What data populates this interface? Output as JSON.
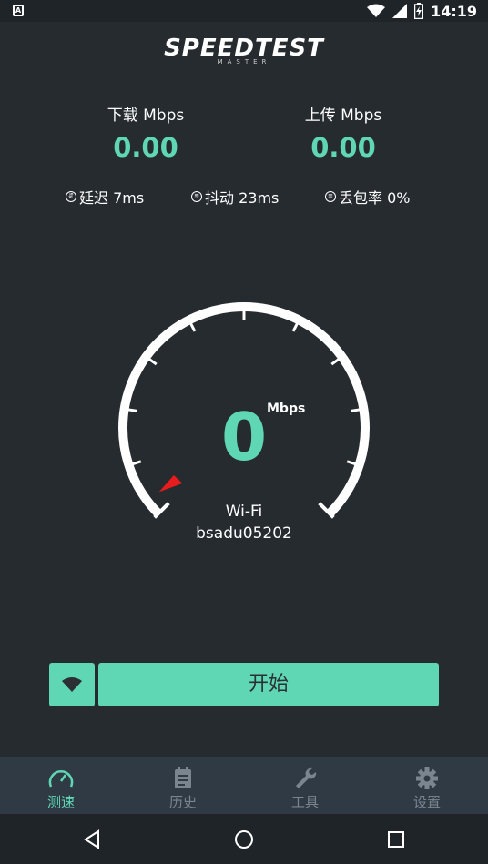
{
  "statusbar": {
    "time": "14:19",
    "left_icon": "A"
  },
  "logo": {
    "main": "SPEEDTEST",
    "sub": "MASTER"
  },
  "download": {
    "label": "下载 Mbps",
    "value": "0.00"
  },
  "upload": {
    "label": "上传 Mbps",
    "value": "0.00"
  },
  "stats": [
    {
      "label": "延迟 7ms",
      "icon": "latency-icon"
    },
    {
      "label": "抖动 23ms",
      "icon": "jitter-icon"
    },
    {
      "label": "丢包率 0%",
      "icon": "packet-loss-icon"
    }
  ],
  "gauge": {
    "value": "0",
    "unit": "Mbps",
    "network_type": "Wi-Fi",
    "ssid": "bsadu05202",
    "level": 0
  },
  "start_button": {
    "label": "开始"
  },
  "tabs": [
    {
      "label": "测速",
      "icon": "speedometer-icon",
      "active": true
    },
    {
      "label": "历史",
      "icon": "calendar-icon",
      "active": false
    },
    {
      "label": "工具",
      "icon": "wrench-icon",
      "active": false
    },
    {
      "label": "设置",
      "icon": "gear-icon",
      "active": false
    }
  ],
  "colors": {
    "accent": "#5fd6b4",
    "background": "#262b30",
    "tabbar": "#2f3a45",
    "needle": "#e81c1c"
  }
}
